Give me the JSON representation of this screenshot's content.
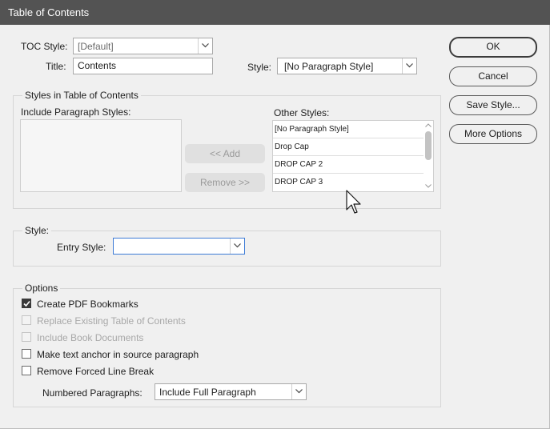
{
  "window": {
    "title": "Table of Contents"
  },
  "toc_style": {
    "label": "TOC Style:",
    "value": "[Default]"
  },
  "title_field": {
    "label": "Title:",
    "value": "Contents"
  },
  "title_style": {
    "label": "Style:",
    "value": "[No Paragraph Style]"
  },
  "styles_group": {
    "legend": "Styles in Table of Contents",
    "include_label": "Include Paragraph Styles:",
    "include_items": [],
    "add_button": "<< Add",
    "remove_button": "Remove >>",
    "other_label": "Other Styles:",
    "other_items": [
      "[No Paragraph Style]",
      "Drop Cap",
      "DROP CAP 2",
      "DROP CAP 3"
    ]
  },
  "style_group": {
    "legend": "Style:",
    "entry_label": "Entry Style:",
    "entry_value": ""
  },
  "options_group": {
    "legend": "Options",
    "checkboxes": [
      {
        "label": "Create PDF Bookmarks",
        "checked": true,
        "enabled": true
      },
      {
        "label": "Replace Existing Table of Contents",
        "checked": false,
        "enabled": false
      },
      {
        "label": "Include Book Documents",
        "checked": false,
        "enabled": false
      },
      {
        "label": "Make text anchor in source paragraph",
        "checked": false,
        "enabled": true
      },
      {
        "label": "Remove Forced Line Break",
        "checked": false,
        "enabled": true
      }
    ],
    "numbered_label": "Numbered Paragraphs:",
    "numbered_value": "Include Full Paragraph"
  },
  "buttons": {
    "ok": "OK",
    "cancel": "Cancel",
    "save_style": "Save Style...",
    "more_options": "More Options"
  },
  "colors": {
    "titlebar": "#535353",
    "dialog_bg": "#f0f0f0",
    "focus_border": "#3d7bd6"
  }
}
